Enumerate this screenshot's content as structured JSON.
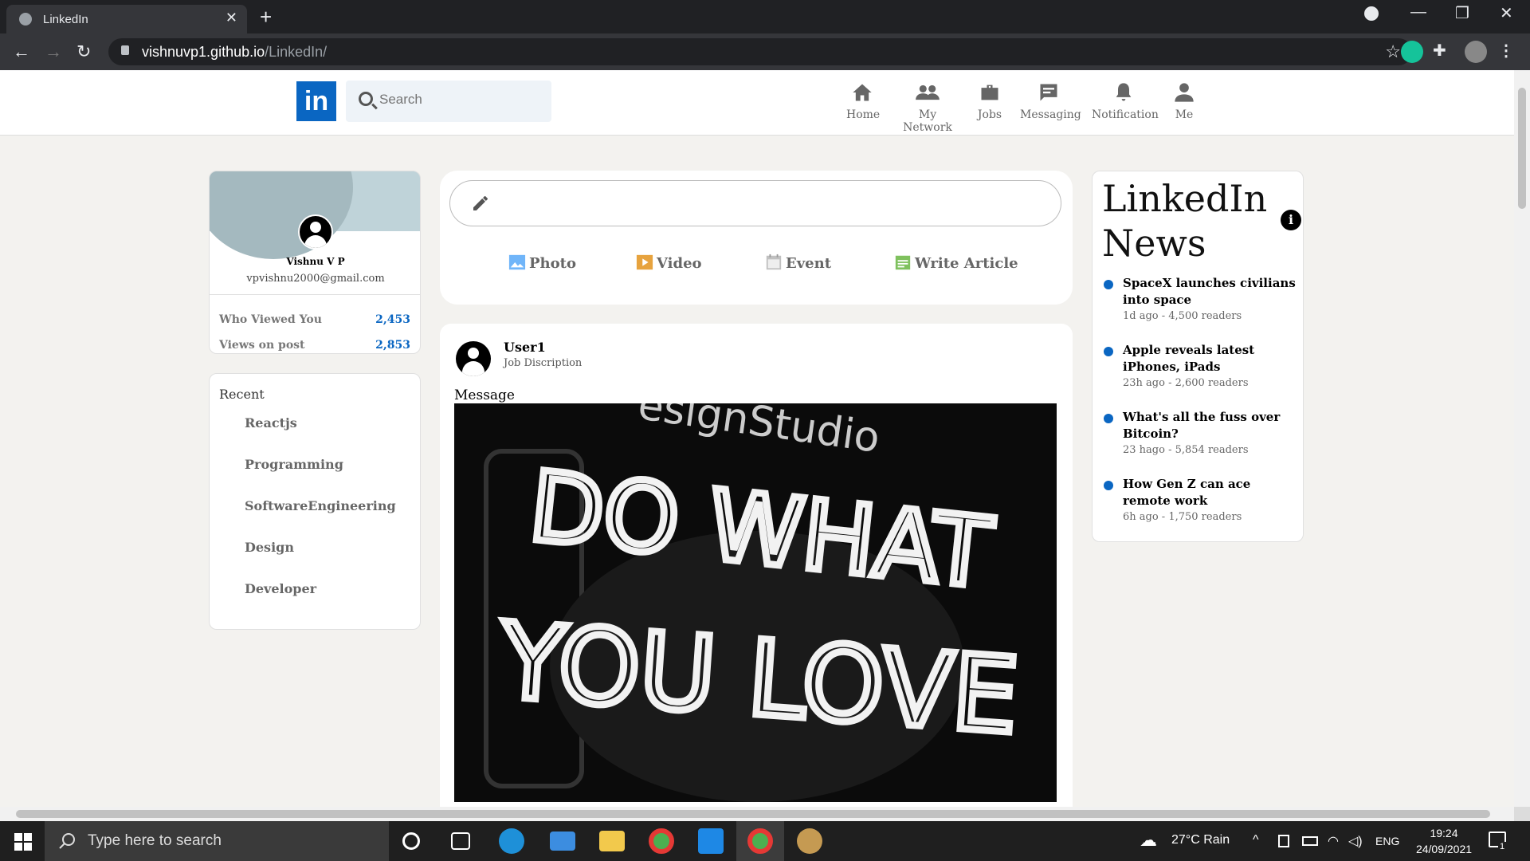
{
  "browser": {
    "tab_title": "LinkedIn",
    "url_host": "vishnuvp1.github.io",
    "url_path": "/LinkedIn/",
    "icons": [
      "back-icon",
      "forward-icon",
      "reload-icon",
      "lock-icon",
      "star-icon",
      "grammarly-icon",
      "extensions-icon",
      "profile-icon",
      "menu-icon"
    ]
  },
  "header": {
    "logo": "in",
    "search_placeholder": "Search",
    "nav": [
      {
        "label": "Home",
        "icon": "home-icon"
      },
      {
        "label": "My Network",
        "icon": "network-icon"
      },
      {
        "label": "Jobs",
        "icon": "briefcase-icon"
      },
      {
        "label": "Messaging",
        "icon": "message-icon"
      },
      {
        "label": "Notification",
        "icon": "bell-icon"
      },
      {
        "label": "Me",
        "icon": "person-icon"
      }
    ]
  },
  "profile": {
    "name": "Vishnu V P",
    "email": "vpvishnu2000@gmail.com",
    "stats": [
      {
        "label": "Who Viewed You",
        "value": "2,453"
      },
      {
        "label": "Views on post",
        "value": "2,853"
      }
    ]
  },
  "recent": {
    "heading": "Recent",
    "items": [
      "Reactjs",
      "Programming",
      "SoftwareEngineering",
      "Design",
      "Developer"
    ]
  },
  "composer": {
    "actions": [
      {
        "label": "Photo",
        "color": "#70b5f9"
      },
      {
        "label": "Video",
        "color": "#e7a33e"
      },
      {
        "label": "Event",
        "color": "#c0c0c0"
      },
      {
        "label": "Write Article",
        "color": "#7fc15e"
      }
    ]
  },
  "post": {
    "user": "User1",
    "job": "Job Discription",
    "message": "Message",
    "image_text": {
      "top": "esignStudio",
      "line1": "DO WHAT",
      "line2": "YOU LOVE"
    }
  },
  "news": {
    "title": "LinkedIn News",
    "items": [
      {
        "headline": "SpaceX launches civilians into space",
        "meta": "1d ago - 4,500 readers"
      },
      {
        "headline": "Apple reveals latest iPhones, iPads",
        "meta": "23h ago - 2,600 readers"
      },
      {
        "headline": "What's all the fuss over Bitcoin?",
        "meta": "23 hago - 5,854 readers"
      },
      {
        "headline": "How Gen Z can ace remote work",
        "meta": "6h ago - 1,750 readers"
      }
    ]
  },
  "taskbar": {
    "search_placeholder": "Type here to search",
    "weather": "27°C  Rain",
    "lang": "ENG",
    "time": "19:24",
    "date": "24/09/2021",
    "notifications": "1"
  }
}
